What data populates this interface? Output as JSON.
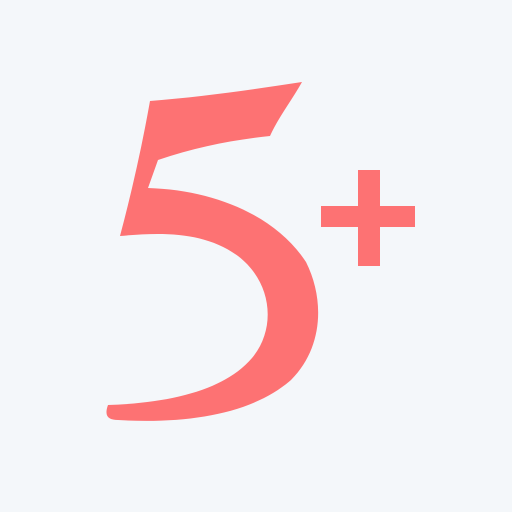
{
  "logo": {
    "text": "5+",
    "color": "#fd7273",
    "background": "#f4f7fa"
  }
}
